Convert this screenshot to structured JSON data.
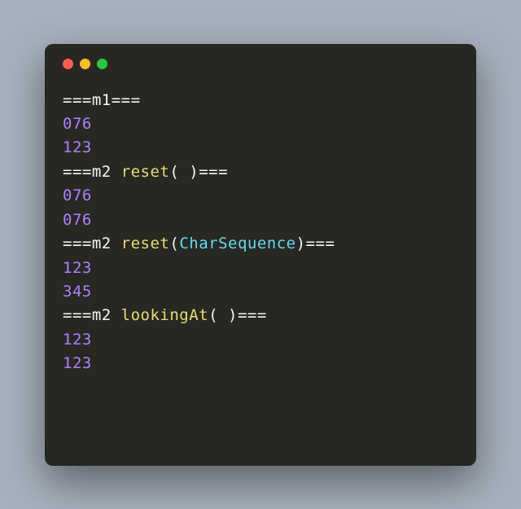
{
  "window": {
    "controls": [
      "close",
      "minimize",
      "zoom"
    ]
  },
  "code": {
    "lines": [
      [
        {
          "cls": "tok-white",
          "text": "==="
        },
        {
          "cls": "tok-white",
          "text": "m1"
        },
        {
          "cls": "tok-white",
          "text": "==="
        }
      ],
      [
        {
          "cls": "tok-num",
          "text": "076"
        }
      ],
      [
        {
          "cls": "tok-num",
          "text": "123"
        }
      ],
      [
        {
          "cls": "tok-white",
          "text": "==="
        },
        {
          "cls": "tok-white",
          "text": "m2"
        },
        {
          "cls": "tok-space",
          "text": " "
        },
        {
          "cls": "tok-call",
          "text": "reset"
        },
        {
          "cls": "tok-white",
          "text": "("
        },
        {
          "cls": "tok-space",
          "text": " "
        },
        {
          "cls": "tok-white",
          "text": ")"
        },
        {
          "cls": "tok-white",
          "text": "==="
        }
      ],
      [
        {
          "cls": "tok-num",
          "text": "076"
        }
      ],
      [
        {
          "cls": "tok-num",
          "text": "076"
        }
      ],
      [
        {
          "cls": "tok-white",
          "text": "==="
        },
        {
          "cls": "tok-white",
          "text": "m2"
        },
        {
          "cls": "tok-space",
          "text": " "
        },
        {
          "cls": "tok-call",
          "text": "reset"
        },
        {
          "cls": "tok-white",
          "text": "("
        },
        {
          "cls": "tok-type",
          "text": "CharSequence"
        },
        {
          "cls": "tok-white",
          "text": ")"
        },
        {
          "cls": "tok-white",
          "text": "==="
        }
      ],
      [
        {
          "cls": "tok-num",
          "text": "123"
        }
      ],
      [
        {
          "cls": "tok-num",
          "text": "345"
        }
      ],
      [
        {
          "cls": "tok-white",
          "text": "==="
        },
        {
          "cls": "tok-white",
          "text": "m2"
        },
        {
          "cls": "tok-space",
          "text": " "
        },
        {
          "cls": "tok-call",
          "text": "lookingAt"
        },
        {
          "cls": "tok-white",
          "text": "("
        },
        {
          "cls": "tok-space",
          "text": " "
        },
        {
          "cls": "tok-white",
          "text": ")"
        },
        {
          "cls": "tok-white",
          "text": "==="
        }
      ],
      [
        {
          "cls": "tok-num",
          "text": "123"
        }
      ],
      [
        {
          "cls": "tok-num",
          "text": "123"
        }
      ]
    ]
  }
}
